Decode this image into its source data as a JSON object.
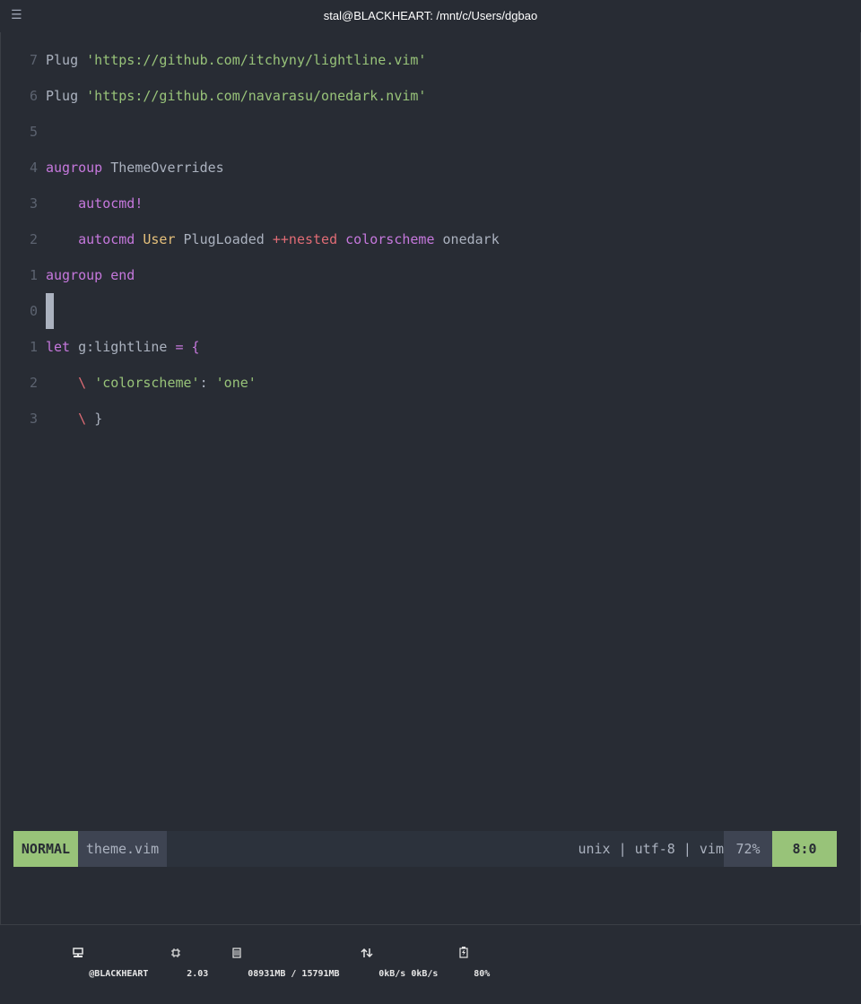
{
  "window": {
    "title": "stal@BLACKHEART: /mnt/c/Users/dgbao",
    "menu_icon": "hamburger-menu-icon"
  },
  "colors": {
    "background": "#282c34",
    "keyword": "#c678dd",
    "string": "#98c379",
    "line_number": "#5c6370",
    "mode_bg": "#98c379",
    "type": "#e5c07b",
    "error": "#e06c75"
  },
  "editor": {
    "lines": [
      {
        "num": "7",
        "tokens": [
          {
            "t": "Plug ",
            "c": "plain"
          },
          {
            "t": "'https://github.com/itchyny/lightline.vim'",
            "c": "str"
          }
        ]
      },
      {
        "num": "6",
        "tokens": [
          {
            "t": "Plug ",
            "c": "plain"
          },
          {
            "t": "'https://github.com/navarasu/onedark.nvim'",
            "c": "str"
          }
        ]
      },
      {
        "num": "5",
        "tokens": []
      },
      {
        "num": "4",
        "tokens": [
          {
            "t": "augroup ",
            "c": "kw"
          },
          {
            "t": "ThemeOverrides",
            "c": "plain"
          }
        ]
      },
      {
        "num": "3",
        "tokens": [
          {
            "t": "    ",
            "c": "plain"
          },
          {
            "t": "autocmd!",
            "c": "kw"
          }
        ]
      },
      {
        "num": "2",
        "tokens": [
          {
            "t": "    ",
            "c": "plain"
          },
          {
            "t": "autocmd ",
            "c": "kw"
          },
          {
            "t": "User ",
            "c": "yel"
          },
          {
            "t": "PlugLoaded ",
            "c": "plain"
          },
          {
            "t": "++nested ",
            "c": "red"
          },
          {
            "t": "colorscheme ",
            "c": "kw"
          },
          {
            "t": "onedark",
            "c": "plain"
          }
        ]
      },
      {
        "num": "1",
        "tokens": [
          {
            "t": "augroup end",
            "c": "kw"
          }
        ]
      },
      {
        "num": "0",
        "tokens": [],
        "cursor": true
      },
      {
        "num": "1",
        "tokens": [
          {
            "t": "let ",
            "c": "kw"
          },
          {
            "t": "g:lightline ",
            "c": "plain"
          },
          {
            "t": "= {",
            "c": "kw"
          }
        ]
      },
      {
        "num": "2",
        "tokens": [
          {
            "t": "    ",
            "c": "plain"
          },
          {
            "t": "\\ ",
            "c": "red"
          },
          {
            "t": "'colorscheme'",
            "c": "str"
          },
          {
            "t": ": ",
            "c": "plain"
          },
          {
            "t": "'one'",
            "c": "str"
          }
        ]
      },
      {
        "num": "3",
        "tokens": [
          {
            "t": "    ",
            "c": "plain"
          },
          {
            "t": "\\ ",
            "c": "red"
          },
          {
            "t": "}",
            "c": "plain"
          }
        ]
      }
    ]
  },
  "statusline": {
    "mode": "NORMAL",
    "filename": "theme.vim",
    "info": "unix | utf-8 | vim",
    "percent": "72%",
    "position": "8:0"
  },
  "tmux": {
    "host": "@BLACKHEART",
    "load": "2.03",
    "memory": "08931MB / 15791MB",
    "network": "0kB/s 0kB/s",
    "battery": "80%"
  }
}
